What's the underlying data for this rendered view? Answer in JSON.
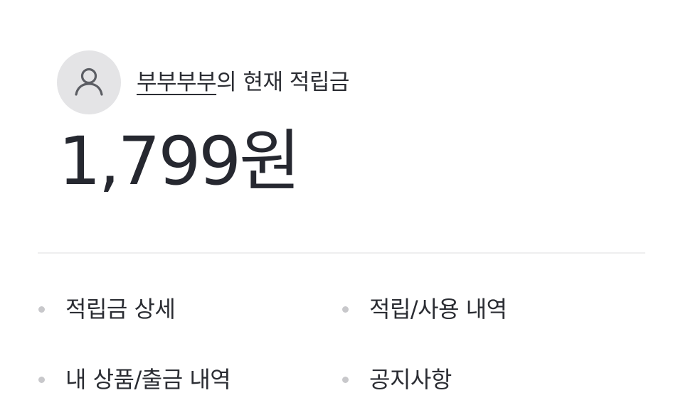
{
  "profile": {
    "avatar_icon": "user-icon",
    "username": "부부부부",
    "greeting_suffix": "의 현재 적립금"
  },
  "balance": {
    "amount": "1,799원"
  },
  "menu": {
    "items": [
      {
        "label": "적립금 상세"
      },
      {
        "label": "적립/사용 내역"
      },
      {
        "label": "내 상품/출금 내역"
      },
      {
        "label": "공지사항"
      }
    ]
  },
  "colors": {
    "text": "#2b2d33",
    "avatar_bg": "#e4e4e6",
    "bullet": "#c8c8cb",
    "divider": "#eeeeef"
  }
}
